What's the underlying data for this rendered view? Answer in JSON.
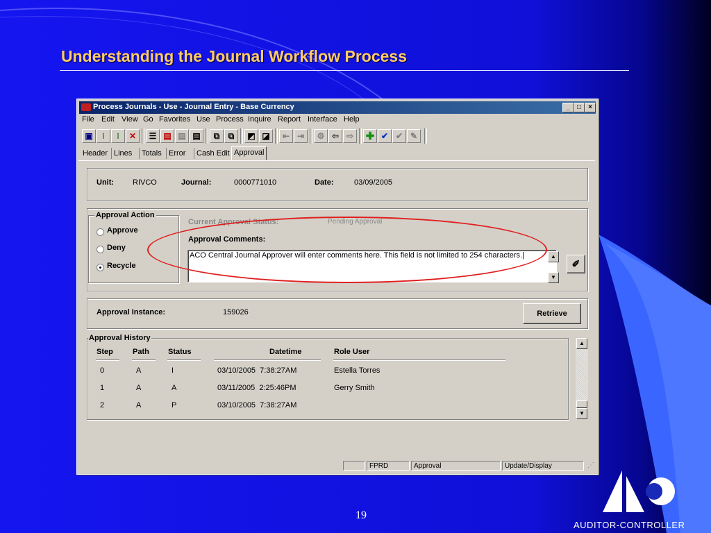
{
  "slide": {
    "title": "Understanding the Journal Workflow Process",
    "page_number": "19",
    "logo_text": "AUDITOR-CONTROLLER",
    "colors": {
      "background": "#1212ee",
      "title": "#ffcc66",
      "accent_shape": "#3a66ff",
      "highlight": "#e02020"
    }
  },
  "window": {
    "title": "Process Journals - Use - Journal Entry - Base Currency",
    "menus": [
      {
        "label": "File"
      },
      {
        "label": "Edit"
      },
      {
        "label": "View"
      },
      {
        "label": "Go"
      },
      {
        "label": "Favorites"
      },
      {
        "label": "Use"
      },
      {
        "label": "Process"
      },
      {
        "label": "Inquire"
      },
      {
        "label": "Report"
      },
      {
        "label": "Interface"
      },
      {
        "label": "Help"
      }
    ],
    "tabs": [
      {
        "label": "Header"
      },
      {
        "label": "Lines"
      },
      {
        "label": "Totals"
      },
      {
        "label": "Error"
      },
      {
        "label": "Cash Edit"
      },
      {
        "label": "Approval"
      }
    ],
    "active_tab": "Approval"
  },
  "header_box": {
    "unit_label": "Unit:",
    "unit_value": "RIVCO",
    "journal_label": "Journal:",
    "journal_value": "0000771010",
    "date_label": "Date:",
    "date_value": "03/09/2005"
  },
  "approval_action": {
    "title": "Approval Action",
    "options": [
      {
        "label": "Approve",
        "selected": false
      },
      {
        "label": "Deny",
        "selected": false
      },
      {
        "label": "Recycle",
        "selected": true
      }
    ]
  },
  "approval_status": {
    "status_label": "Current Approval Status:",
    "status_value": "Pending Approval",
    "comments_label": "Approval Comments:",
    "comments_value": "ACO Central Journal Approver will enter comments here. This field is not limited to 254 characters."
  },
  "instance": {
    "label": "Approval Instance:",
    "value": "159026",
    "retrieve_label": "Retrieve"
  },
  "history": {
    "title": "Approval History",
    "columns": [
      "Step",
      "Path",
      "Status",
      "Datetime",
      "Role User"
    ],
    "rows": [
      {
        "step": "0",
        "path": "A",
        "status": "I",
        "datetime": "03/10/2005  7:38:27AM",
        "user": "Estella Torres"
      },
      {
        "step": "1",
        "path": "A",
        "status": "A",
        "datetime": "03/11/2005  2:25:46PM",
        "user": "Gerry Smith"
      },
      {
        "step": "2",
        "path": "A",
        "status": "P",
        "datetime": "03/10/2005  7:38:27AM",
        "user": ""
      }
    ]
  },
  "statusbar": {
    "db": "FPRD",
    "page": "Approval",
    "mode": "Update/Display"
  },
  "toolbar_icons": [
    "save-icon",
    "traffic-light-icon",
    "traffic-light-alert-icon",
    "delete-icon",
    "list-icon",
    "insert-row-icon",
    "delete-row-icon",
    "page-icon",
    "copy-icon",
    "paste-icon",
    "next-icon",
    "prev-icon",
    "first-icon",
    "last-icon",
    "gear-icon",
    "back-arrow-icon",
    "forward-arrow-icon",
    "add-icon",
    "check-icon",
    "check-grey-icon",
    "pencil-icon"
  ]
}
